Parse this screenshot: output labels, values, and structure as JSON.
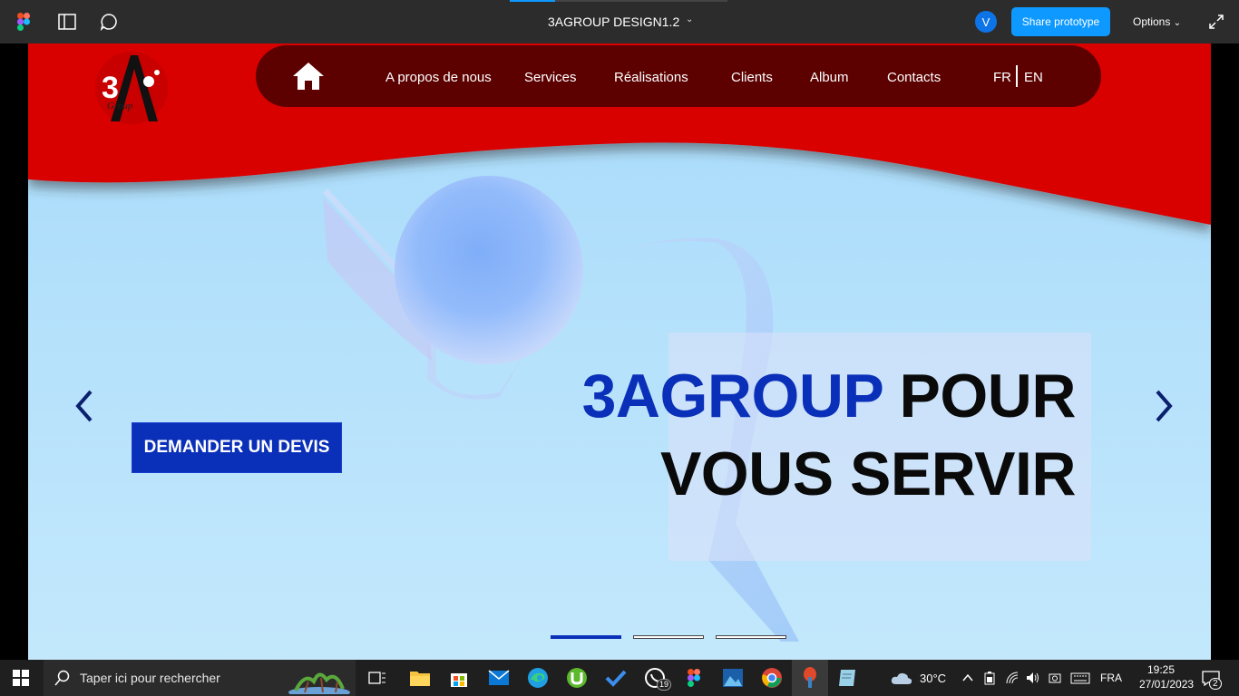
{
  "figma_toolbar": {
    "file_title": "3AGROUP DESIGN1.2",
    "avatar_initial": "V",
    "share_label": "Share prototype",
    "options_label": "Options"
  },
  "site": {
    "nav": {
      "items": [
        "A propos de nous",
        "Services",
        "Réalisations",
        "Clients",
        "Album",
        "Contacts"
      ],
      "lang_fr": "FR",
      "lang_en": "EN"
    },
    "hero": {
      "brand": "3AGROUP",
      "line1_rest": " POUR",
      "line2": "VOUS SERVIR",
      "cta_label": "DEMANDER UN DEVIS"
    },
    "slider": {
      "active_index": 0,
      "total": 3
    },
    "colors": {
      "header_red": "#d90000",
      "nav_bg": "#5c0000",
      "brand_blue": "#0a2fb8",
      "sky": "#b3e0fb"
    }
  },
  "taskbar": {
    "search_placeholder": "Taper ici pour rechercher",
    "whatsapp_badge": "19",
    "temperature": "30°C",
    "language": "FRA",
    "time": "19:25",
    "date": "27/01/2023",
    "notification_count": "2",
    "apps": [
      "task-view",
      "file-explorer",
      "microsoft-store",
      "mail",
      "edge",
      "utorrent",
      "todo",
      "whatsapp",
      "figma",
      "photos",
      "chrome",
      "app-active",
      "notepad"
    ]
  }
}
